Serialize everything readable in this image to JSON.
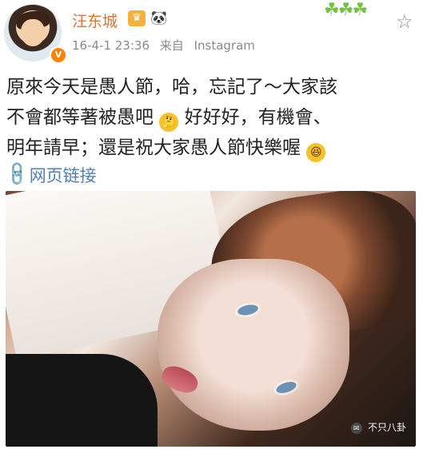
{
  "header": {
    "username": "汪东城",
    "time": "16-4-1 23:36",
    "source_prefix": "来自",
    "source": "Instagram"
  },
  "post": {
    "line1": "原來今天是愚人節，哈，忘記了～大家該",
    "line2": "不會都等著被愚吧",
    "line2b": "好好好，有機會、",
    "line3": "明年請早；還是祝大家愚人節快樂喔",
    "link": "网页链接"
  },
  "watermark": {
    "text": "不只八卦"
  },
  "icons": {
    "verified": "verified-icon",
    "crown": "crown-icon",
    "panda": "panda-icon",
    "clover": "clover-icon",
    "star": "star-icon",
    "thinking": "thinking-face-icon",
    "laughing": "laughing-face-icon",
    "link": "link-icon"
  }
}
